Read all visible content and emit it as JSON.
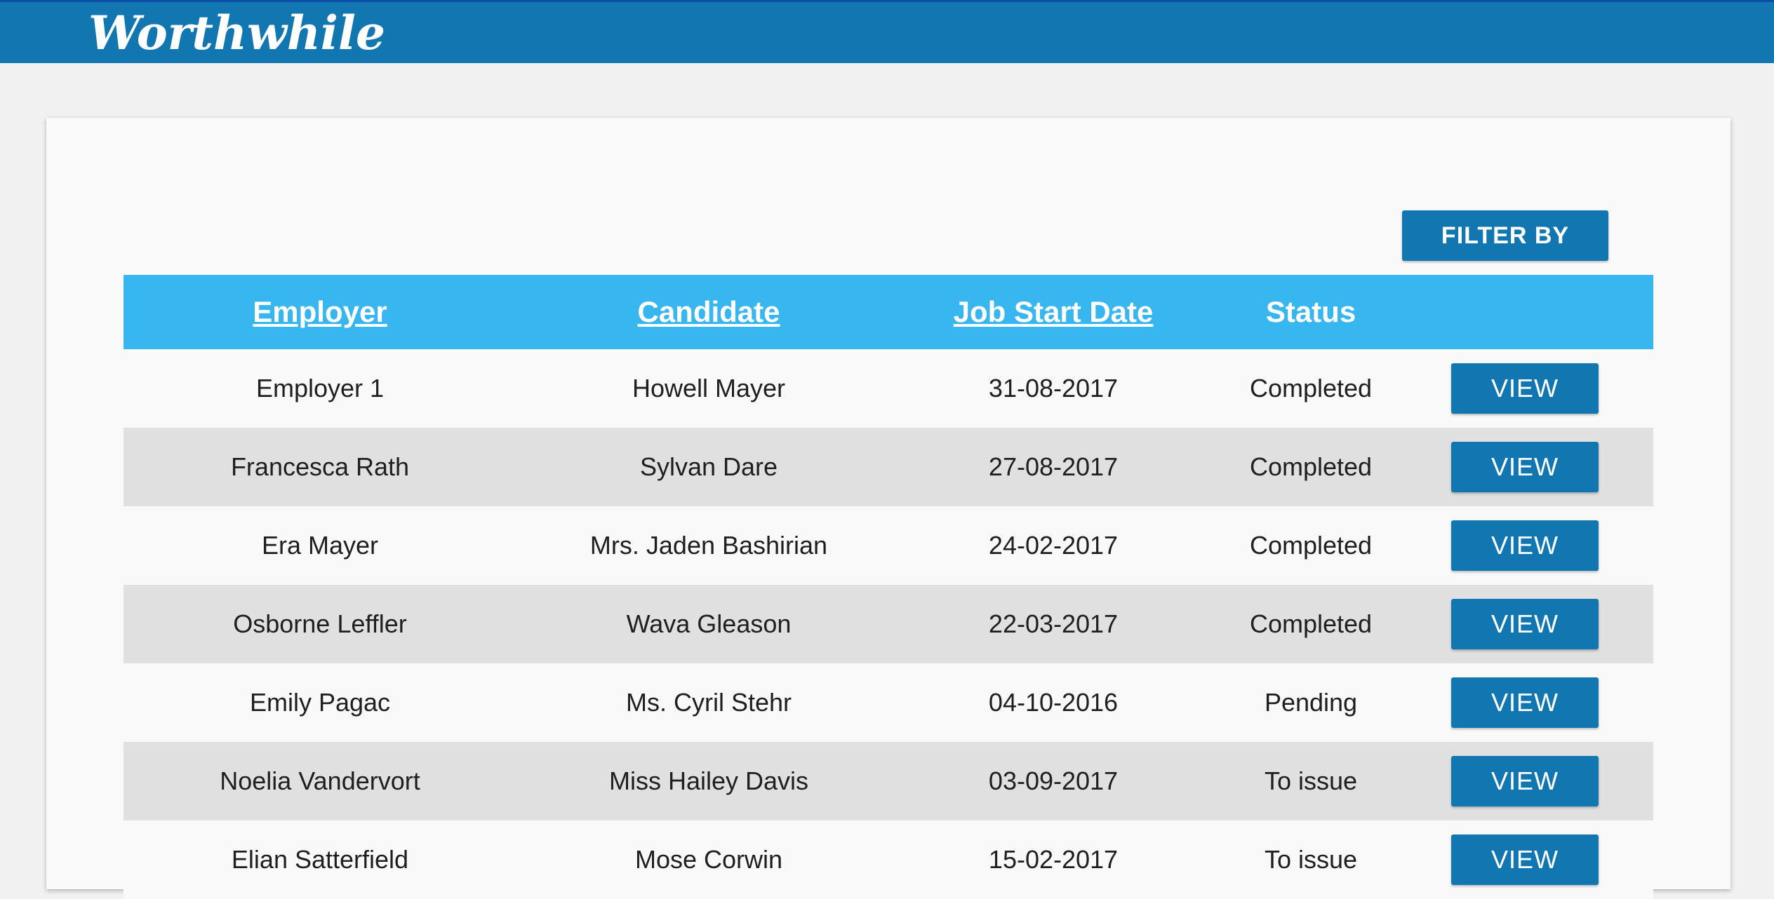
{
  "header": {
    "logo_text": "Worthwhile"
  },
  "toolbar": {
    "filter_label": "FILTER BY"
  },
  "table": {
    "columns": [
      "Employer",
      "Candidate",
      "Job Start Date",
      "Status",
      ""
    ],
    "action_label": "VIEW",
    "rows": [
      {
        "employer": "Employer 1",
        "candidate": "Howell Mayer",
        "start_date": "31-08-2017",
        "status": "Completed"
      },
      {
        "employer": "Francesca Rath",
        "candidate": "Sylvan Dare",
        "start_date": "27-08-2017",
        "status": "Completed"
      },
      {
        "employer": "Era Mayer",
        "candidate": "Mrs. Jaden Bashirian",
        "start_date": "24-02-2017",
        "status": "Completed"
      },
      {
        "employer": "Osborne Leffler",
        "candidate": "Wava Gleason",
        "start_date": "22-03-2017",
        "status": "Completed"
      },
      {
        "employer": "Emily Pagac",
        "candidate": "Ms. Cyril Stehr",
        "start_date": "04-10-2016",
        "status": "Pending"
      },
      {
        "employer": "Noelia Vandervort",
        "candidate": "Miss Hailey Davis",
        "start_date": "03-09-2017",
        "status": "To issue"
      },
      {
        "employer": "Elian Satterfield",
        "candidate": "Mose Corwin",
        "start_date": "15-02-2017",
        "status": "To issue"
      }
    ]
  },
  "colors": {
    "brand": "#1277b1",
    "header_row": "#38b6f0",
    "row_alt": "#e0e0e0"
  }
}
